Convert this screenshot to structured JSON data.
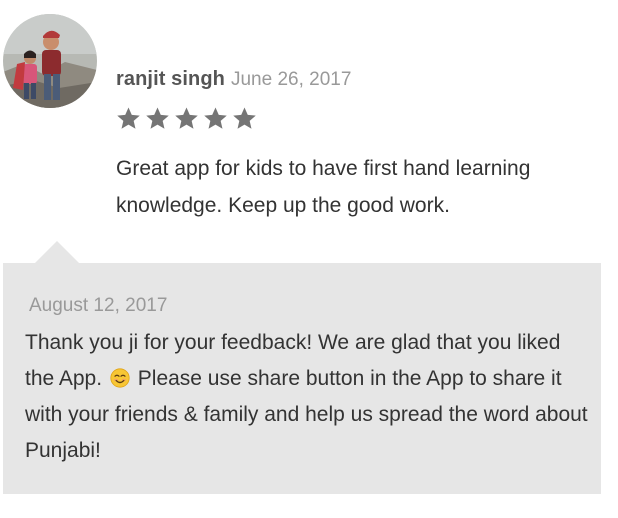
{
  "review": {
    "author": "ranjit singh",
    "date": "June 26, 2017",
    "rating": 5,
    "rating_max": 5,
    "star_color": "#757575",
    "text": "Great app for kids to have first hand learning knowledge. Keep up the good work."
  },
  "reply": {
    "date": "August 12, 2017",
    "text_before_emoji": "Thank you ji for your feedback! We are glad that you liked the App.",
    "emoji": "smiling-face-emoji",
    "text_after_emoji": "Please use share button in the App to share it with your friends & family and help us spread the word about Punjabi!",
    "background_color": "#e6e6e6"
  }
}
